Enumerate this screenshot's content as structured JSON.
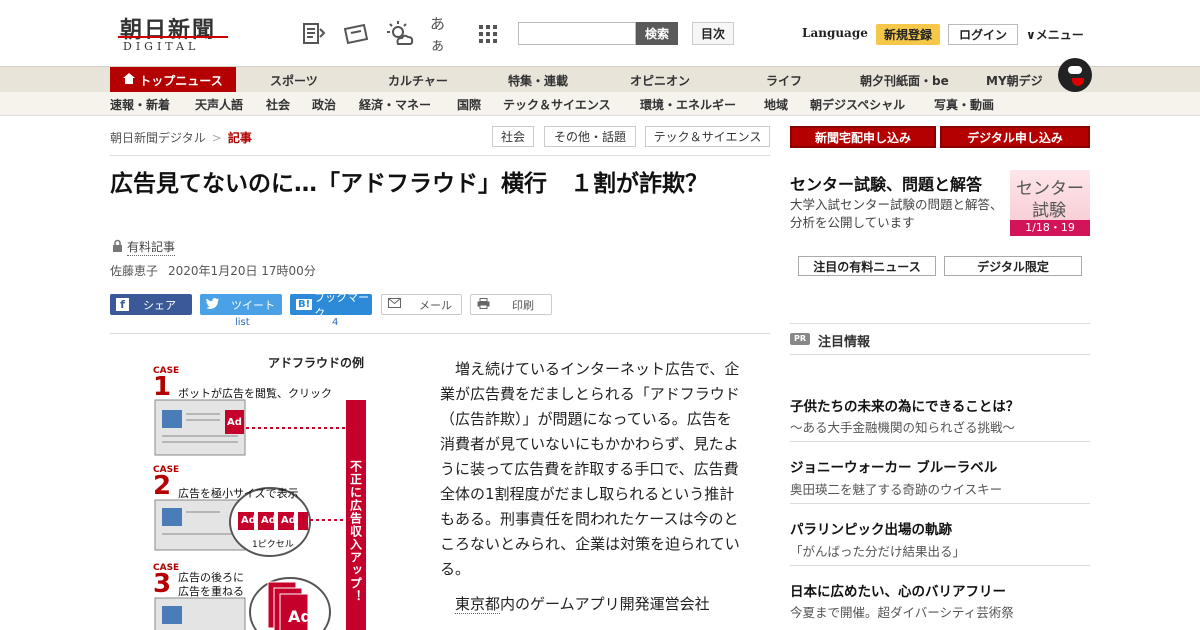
{
  "header": {
    "logo_main": "朝日新聞",
    "logo_sub": "DIGITAL",
    "text_size_label": "あぁ",
    "search_button": "検索",
    "index_button": "目次",
    "language": "Language",
    "signup": "新規登録",
    "login": "ログイン",
    "menu": "メニュー"
  },
  "nav_primary": [
    "トップニュース",
    "スポーツ",
    "カルチャー",
    "特集・連載",
    "オピニオン",
    "ライフ",
    "朝夕刊紙面・be",
    "MY朝デジ"
  ],
  "nav_secondary": [
    "速報・新着",
    "天声人語",
    "社会",
    "政治",
    "経済・マネー",
    "国際",
    "テック＆サイエンス",
    "環境・エネルギー",
    "地域",
    "朝デジスペシャル",
    "写真・動画"
  ],
  "breadcrumb": {
    "home": "朝日新聞デジタル",
    "sep": ">",
    "current": "記事"
  },
  "tags": [
    "社会",
    "その他・話題",
    "テック＆サイエンス"
  ],
  "article": {
    "headline": "広告見てないのに…「アドフラウド」横行　１割が詐欺？",
    "paid_label": "有料記事",
    "author": "佐藤恵子",
    "date": "2020年1月20日 17時00分",
    "share": {
      "facebook": "シェア",
      "twitter": "ツイート",
      "hatena": "ブックマーク",
      "mail": "メール",
      "print": "印刷",
      "twitter_count": "list",
      "hatena_count": "4"
    },
    "figure": {
      "title": "アドフラウドの例",
      "case_label": "CASE",
      "cases": [
        {
          "num": "1",
          "text": "ボットが広告を閲覧、クリック"
        },
        {
          "num": "2",
          "text": "広告を極小サイズで表示"
        },
        {
          "num": "3",
          "text": "広告の後ろに広告を重ねる"
        }
      ],
      "ad": "Ad",
      "pixel": "1ピクセル",
      "bar": "不正に広告収入アップ！"
    },
    "para1": "増え続けているインターネット広告で、企業が広告費をだましとられる「アドフラウド（広告詐欺）」が問題になっている。広告を消費者が見ていないにもかかわらず、見たように装って広告費を詐取する手口で、広告費全体の1割程度がだまし取られるという推計もある。刑事責任を問われたケースは今のところないとみられ、企業は対策を迫られている。",
    "para2_link": "東京都",
    "para2_rest": "内のゲームアプリ開発運営会社"
  },
  "sidebar": {
    "btn_newspaper": "新聞宅配申し込み",
    "btn_digital": "デジタル申し込み",
    "center_title": "センター試験、問題と解答",
    "center_desc": "大学入試センター試験の問題と解答、分析を公開しています",
    "center_img_1": "センター",
    "center_img_2": "試験",
    "center_img_date": "1/18・19",
    "tab_paid": "注目の有料ニュース",
    "tab_digital": "デジタル限定",
    "pr_badge": "PR",
    "pr_heading": "注目情報",
    "pr_items": [
      {
        "title": "子供たちの未来の為にできることは？",
        "sub": "～ある大手金融機関の知られざる挑戦～"
      },
      {
        "title": "ジョニーウォーカー ブルーラベル",
        "sub": "奥田瑛二を魅了する奇跡のウイスキー"
      },
      {
        "title": "パラリンピック出場の軌跡",
        "sub": "「がんばった分だけ結果出る」"
      },
      {
        "title": "日本に広めたい、心のバリアフリー",
        "sub": "今夏まで開催。超ダイバーシティ芸術祭"
      }
    ]
  },
  "colors": {
    "brand_red": "#b40000",
    "signup_yellow": "#f5c84a",
    "nav_bg": "#e8e4da"
  },
  "icons": [
    "newspaper-icon",
    "ticket-icon",
    "weather-icon",
    "text-size-icon",
    "grid-icon",
    "home-icon",
    "lock-icon",
    "facebook-icon",
    "twitter-icon",
    "hatena-icon",
    "mail-icon",
    "print-icon",
    "chevron-down-icon"
  ]
}
